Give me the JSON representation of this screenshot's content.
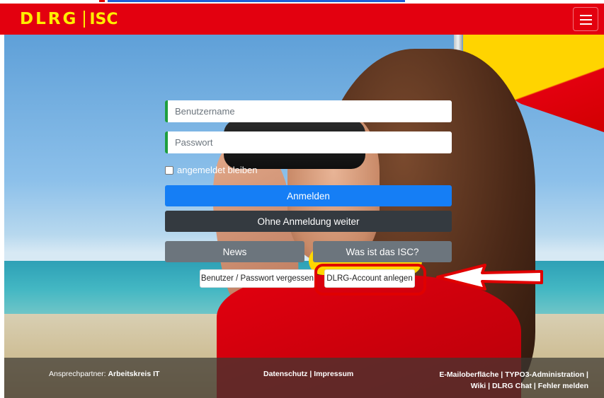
{
  "header": {
    "logo_text": "DLRG",
    "app_name": "ISC",
    "brand_yellow": "#ffed00",
    "brand_red": "#e3000f"
  },
  "login": {
    "username_placeholder": "Benutzername",
    "password_placeholder": "Passwort",
    "remember_label": "angemeldet bleiben",
    "login_button": "Anmelden",
    "guest_button": "Ohne Anmeldung weiter",
    "news_button": "News",
    "about_button": "Was ist das ISC?",
    "forgot_button": "Benutzer / Passwort vergessen",
    "create_account_button": "DLRG-Account anlegen"
  },
  "footer": {
    "contact_prefix": "Ansprechpartner: ",
    "contact_link": "Arbeitskreis IT",
    "privacy": "Datenschutz",
    "separator": " | ",
    "imprint": "Impressum",
    "mail": "E-Mailoberfläche",
    "typo3": "TYPO3-Administration",
    "wiki": "Wiki",
    "chat": "DLRG Chat",
    "report": "Fehler melden"
  },
  "annotation": {
    "color": "#e00000"
  }
}
